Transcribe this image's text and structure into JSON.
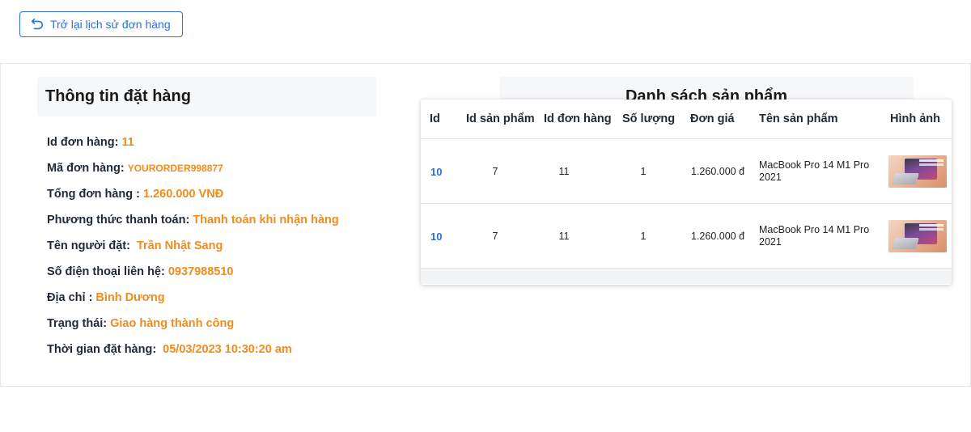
{
  "back_button": {
    "label": "Trở lại lịch sử đơn hàng",
    "icon": "undo-arrow-icon"
  },
  "order_info": {
    "title": "Thông tin đặt hàng",
    "rows": [
      {
        "label": "Id đơn hàng:",
        "value": "11"
      },
      {
        "label": "Mã đơn hàng:",
        "value": "YOURORDER998877"
      },
      {
        "label": "Tổng đơn hàng :",
        "value": "1.260.000 VNĐ"
      },
      {
        "label": "Phương thức thanh toán:",
        "value": "Thanh toán khi nhận hàng"
      },
      {
        "label": "Tên người đặt:",
        "value": "Trần Nhật Sang"
      },
      {
        "label": "Số điện thoại liên hệ:",
        "value": "0937988510"
      },
      {
        "label": "Địa chỉ :",
        "value": "Bình Dương"
      },
      {
        "label": "Trạng thái:",
        "value": "Giao hàng thành công"
      },
      {
        "label": "Thời gian đặt hàng:",
        "value": "05/03/2023 10:30:20 am"
      }
    ]
  },
  "products": {
    "title": "Danh sách sản phẩm",
    "columns": [
      "Id",
      "Id sản phẩm",
      "Id đơn hàng",
      "Số lượng",
      "Đơn giá",
      "Tên sản phẩm",
      "Hình ảnh"
    ],
    "rows": [
      {
        "id": "10",
        "product_id": "7",
        "order_id": "11",
        "quantity": "1",
        "price": "1.260.000 đ",
        "name": "MacBook Pro 14 M1 Pro 2021",
        "image": "macbook-thumbnail"
      },
      {
        "id": "10",
        "product_id": "7",
        "order_id": "11",
        "quantity": "1",
        "price": "1.260.000 đ",
        "name": "MacBook Pro 14 M1 Pro 2021",
        "image": "macbook-thumbnail"
      }
    ]
  },
  "colors": {
    "accent": "#2f6fd6",
    "value": "#f28b1d",
    "panel": "#f6f7f9"
  }
}
